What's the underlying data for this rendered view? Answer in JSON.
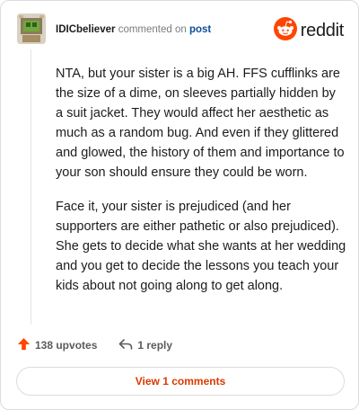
{
  "comment": {
    "username": "IDICbeliever",
    "verb": "commented on",
    "target": "post",
    "paragraphs": [
      "NTA, but your sister is a big AH. FFS cufflinks are the size of a dime, on sleeves partially hidden by a suit jacket. They would affect her aesthetic as much as a random bug. And even if they glittered and glowed, the history of them and importance to your son should ensure they could be worn.",
      "Face it, your sister is prejudiced (and her supporters are either pathetic or also prejudiced). She gets to decide what she wants at her wedding and you get to decide the lessons you teach your kids about not going along to get along."
    ],
    "upvotes": "138 upvotes",
    "replies": "1 reply",
    "view_comments": "View 1 comments"
  },
  "brand": {
    "name": "reddit",
    "accent": "#ff4500"
  },
  "icons": {
    "avatar": "user-avatar",
    "logo": "reddit-logo-icon",
    "upvote": "upvote-arrow-icon",
    "reply": "reply-arrow-icon"
  }
}
